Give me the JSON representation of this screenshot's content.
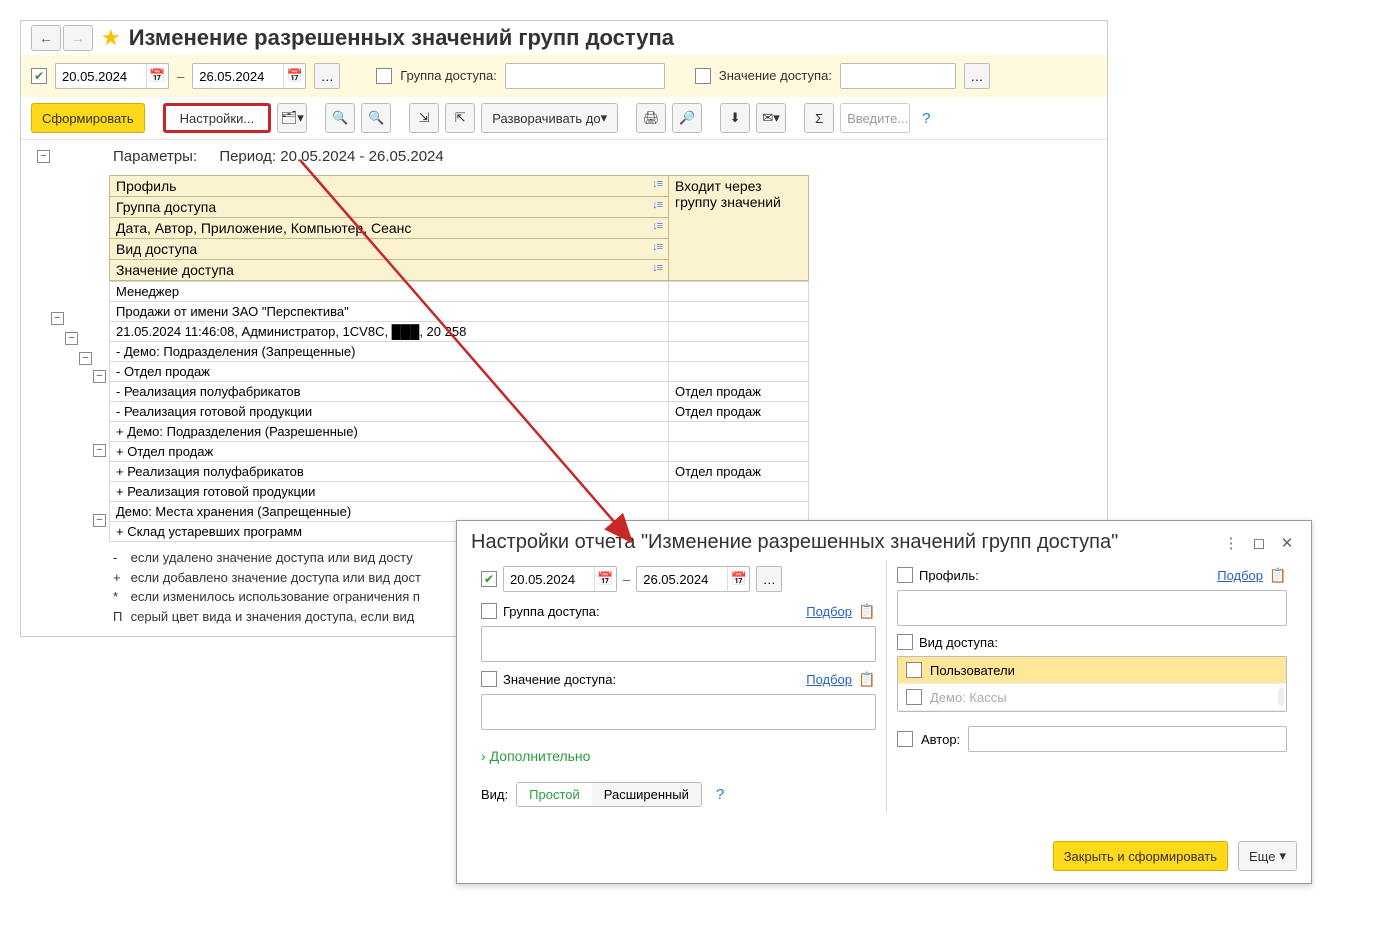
{
  "main": {
    "title": "Изменение разрешенных значений групп доступа",
    "nav": {
      "back": "←",
      "fwd": "→"
    },
    "filter": {
      "date_from": "20.05.2024",
      "date_to": "26.05.2024",
      "group_label": "Группа доступа:",
      "value_label": "Значение доступа:"
    },
    "toolbar": {
      "generate": "Сформировать",
      "settings": "Настройки...",
      "expand": "Разворачивать до",
      "find_placeholder": "Введите..."
    },
    "report": {
      "params_label": "Параметры:",
      "params_value": "Период: 20.05.2024 - 26.05.2024",
      "header_rows": [
        "Профиль",
        "Группа доступа",
        "Дата, Автор, Приложение, Компьютер, Сеанс",
        "Вид доступа",
        "Значение доступа"
      ],
      "header_right": "Входит через группу значений",
      "rows": [
        {
          "c1": "Менеджер",
          "c2": "",
          "ind": 0
        },
        {
          "c1": "Продажи от имени ЗАО \"Перспектива\"",
          "c2": "",
          "ind": 1
        },
        {
          "c1": "21.05.2024 11:46:08, Администратор, 1CV8C, ███, 20 258",
          "c2": "",
          "ind": 2
        },
        {
          "c1": "- Демо: Подразделения (Запрещенные)",
          "c2": "",
          "ind": 3
        },
        {
          "c1": "- Отдел продаж",
          "c2": "",
          "ind": 4
        },
        {
          "c1": "- Реализация полуфабрикатов",
          "c2": "Отдел продаж",
          "ind": 4
        },
        {
          "c1": "- Реализация готовой продукции",
          "c2": "Отдел продаж",
          "ind": 4
        },
        {
          "c1": "+ Демо: Подразделения (Разрешенные)",
          "c2": "",
          "ind": 3
        },
        {
          "c1": "+ Отдел продаж",
          "c2": "",
          "ind": 4
        },
        {
          "c1": "+ Реализация полуфабрикатов",
          "c2": "Отдел продаж",
          "ind": 4
        },
        {
          "c1": "+ Реализация готовой продукции",
          "c2": "",
          "ind": 4
        },
        {
          "c1": "Демо: Места хранения (Запрещенные)",
          "c2": "",
          "ind": 3
        },
        {
          "c1": "+ Склад устаревших программ",
          "c2": "",
          "ind": 4
        }
      ],
      "legend": [
        {
          "mk": "-",
          "txt": "если удалено значение доступа или вид досту"
        },
        {
          "mk": "+",
          "txt": "если добавлено значение доступа или вид дост"
        },
        {
          "mk": "*",
          "txt": "если изменилось использование ограничения п"
        },
        {
          "mk": "П",
          "txt": "серый цвет вида и значения доступа, если вид"
        }
      ]
    }
  },
  "popup": {
    "title": "Настройки отчета \"Изменение разрешенных значений групп доступа\"",
    "date_from": "20.05.2024",
    "date_to": "26.05.2024",
    "dash": "–",
    "group_label": "Группа доступа:",
    "value_label": "Значение доступа:",
    "profile_label": "Профиль:",
    "access_type_label": "Вид доступа:",
    "author_label": "Автор:",
    "select_link": "Подбор",
    "list": [
      {
        "txt": "Пользователи",
        "sel": true
      },
      {
        "txt": "Демо: Кассы",
        "dis": true
      }
    ],
    "additional": "Дополнительно",
    "view_label": "Вид:",
    "view_simple": "Простой",
    "view_advanced": "Расширенный",
    "close_generate": "Закрыть и сформировать",
    "more": "Еще"
  }
}
